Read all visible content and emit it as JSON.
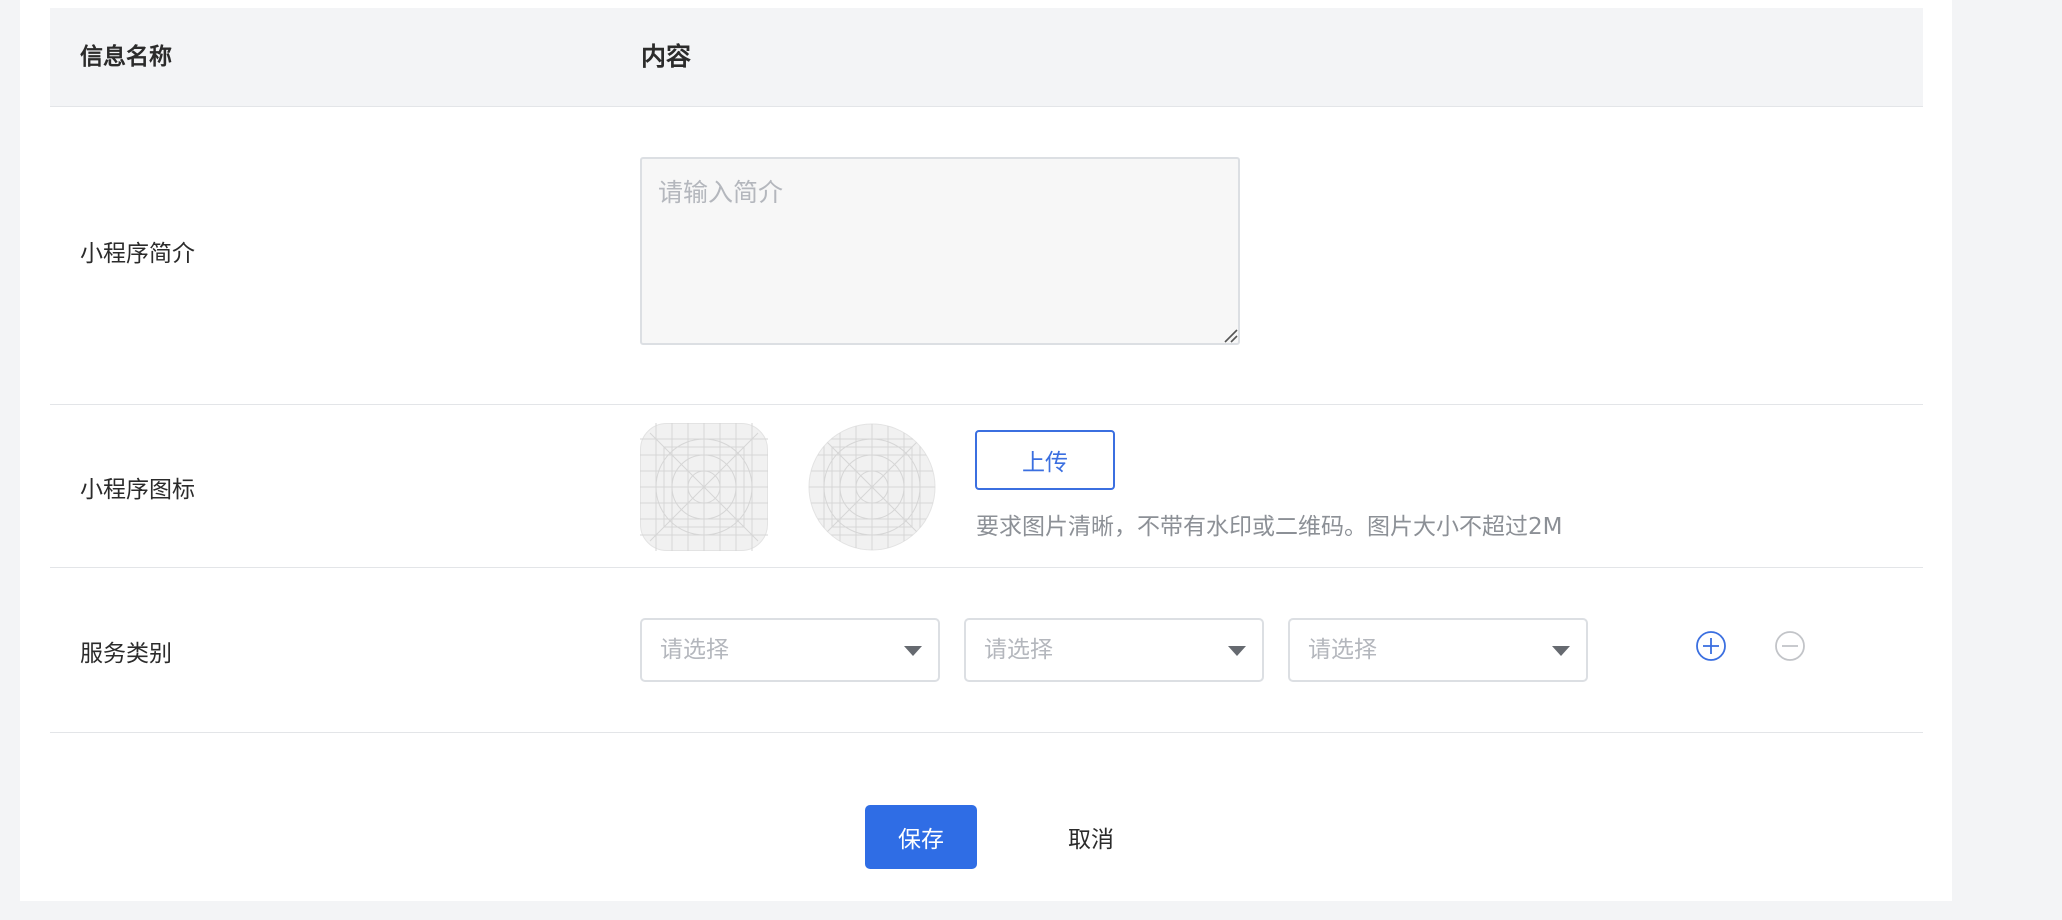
{
  "table": {
    "header": {
      "name_col": "信息名称",
      "content_col": "内容"
    },
    "rows": {
      "intro": {
        "label": "小程序简介",
        "placeholder": "请输入简介",
        "value": ""
      },
      "icon": {
        "label": "小程序图标",
        "upload_label": "上传",
        "hint": "要求图片清晰，不带有水印或二维码。图片大小不超过2M"
      },
      "service": {
        "label": "服务类别",
        "selects": [
          {
            "placeholder": "请选择"
          },
          {
            "placeholder": "请选择"
          },
          {
            "placeholder": "请选择"
          }
        ]
      }
    }
  },
  "actions": {
    "save_label": "保存",
    "cancel_label": "取消"
  },
  "colors": {
    "primary": "#2f6de5",
    "page_bg": "#f3f4f6",
    "placeholder": "#b4b7bd",
    "hint": "#8c9096"
  },
  "icons": {
    "upload_preview_square": "app-icon-placeholder-square",
    "upload_preview_circle": "app-icon-placeholder-circle",
    "add": "plus-circle-icon",
    "remove": "minus-circle-icon",
    "dropdown": "caret-down-icon"
  }
}
